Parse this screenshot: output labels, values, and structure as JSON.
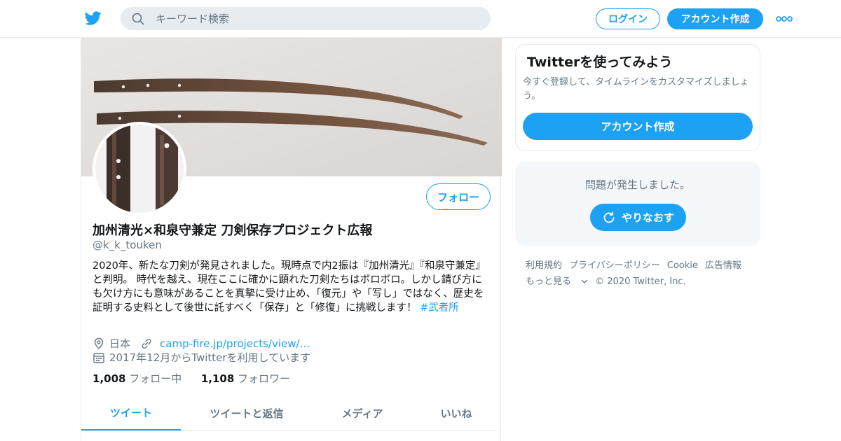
{
  "header": {
    "logo_icon": "twitter-bird-icon",
    "search_placeholder": "キーワード検索",
    "login_label": "ログイン",
    "signup_label": "アカウント作成",
    "more_icon": "more-dots-icon"
  },
  "profile": {
    "follow_label": "フォロー",
    "display_name": "加州清光×和泉守兼定 刀剣保存プロジェクト広報",
    "handle": "@k_k_touken",
    "bio": "2020年、新たな刀剣が発見されました。現時点で内2振は『加州清光』『和泉守兼定』と判明。 時代を越え、現在ここに確かに顕れた刀剣たちはボロボロ。しかし錆び方にも欠け方にも意味があることを真摯に受け止め、「復元」や「写し」ではなく、歴史を証明する史料として後世に託すべく「保存」と「修復」に挑戦します！ ",
    "bio_hashtag": "#武者所",
    "location": "日本",
    "website": "camp-fire.jp/projects/view/…",
    "joined": "2017年12月からTwitterを利用しています",
    "following_count": "1,008",
    "following_label": "フォロー中",
    "followers_count": "1,108",
    "followers_label": "フォロワー"
  },
  "tabs": [
    {
      "label": "ツイート"
    },
    {
      "label": "ツイートと返信"
    },
    {
      "label": "メディア"
    },
    {
      "label": "いいね"
    }
  ],
  "signup_card": {
    "title": "Twitterを使ってみよう",
    "description": "今すぐ登録して、タイムラインをカスタマイズしましょう。",
    "button_label": "アカウント作成"
  },
  "error_box": {
    "message": "問題が発生しました。",
    "retry_label": "やりなおす"
  },
  "footer": {
    "links": [
      "利用規約",
      "プライバシーポリシー",
      "Cookie",
      "広告情報",
      "もっと見る"
    ],
    "copyright": "© 2020 Twitter, Inc."
  },
  "colors": {
    "accent": "#1da1f2",
    "text_secondary": "#657786",
    "border": "#e6ecf0"
  }
}
